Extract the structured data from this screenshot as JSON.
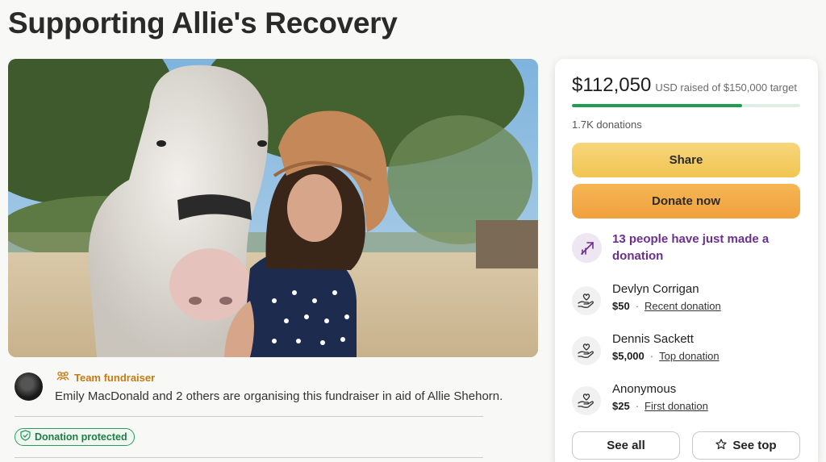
{
  "page": {
    "title": "Supporting Allie's Recovery"
  },
  "organiser": {
    "badge_label": "Team fundraiser",
    "text": "Emily MacDonald and 2 others are organising this fundraiser in aid of Allie Shehorn.",
    "protected_label": "Donation protected"
  },
  "progress": {
    "raised": "$112,050",
    "raised_text": "USD raised of $150,000 target",
    "fraction": 0.747,
    "donations_count": "1.7K donations"
  },
  "actions": {
    "share_label": "Share",
    "donate_label": "Donate now"
  },
  "notice": {
    "text": "13 people have just made a donation"
  },
  "donors": [
    {
      "name": "Devlyn Corrigan",
      "amount": "$50",
      "kind": "Recent donation"
    },
    {
      "name": "Dennis Sackett",
      "amount": "$5,000",
      "kind": "Top donation"
    },
    {
      "name": "Anonymous",
      "amount": "$25",
      "kind": "First donation"
    }
  ],
  "footer_buttons": {
    "see_all_label": "See all",
    "see_top_label": "See top"
  },
  "colors": {
    "progress": "#1e9e52",
    "notice": "#6b2f8e",
    "share": "#f1c552",
    "donate": "#f0a03c",
    "team": "#c47a12",
    "protected": "#237a47"
  },
  "icons": [
    "team-icon",
    "shield-check-icon",
    "trending-up-icon",
    "hand-heart-icon",
    "star-icon"
  ]
}
